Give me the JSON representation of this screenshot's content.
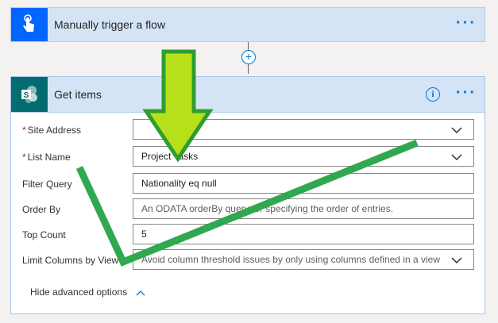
{
  "trigger": {
    "title": "Manually trigger a flow",
    "icon": "touch-hand-icon",
    "color": "#0066ff"
  },
  "action": {
    "title": "Get items",
    "icon": "sharepoint-icon",
    "color": "#036c70",
    "info_symbol": "i",
    "fields": {
      "site_address": {
        "label": "Site Address",
        "required": "*",
        "value": ""
      },
      "list_name": {
        "label": "List Name",
        "required": "*",
        "value": "Project Tasks"
      },
      "filter_query": {
        "label": "Filter Query",
        "value": "Nationality eq null"
      },
      "order_by": {
        "label": "Order By",
        "placeholder": "An ODATA orderBy query for specifying the order of entries."
      },
      "top_count": {
        "label": "Top Count",
        "value": "5"
      },
      "limit_columns": {
        "label": "Limit Columns by View",
        "placeholder": "Avoid column threshold issues by only using columns defined in a view"
      }
    },
    "advanced_toggle": "Hide advanced options"
  },
  "ellipsis": "···",
  "add_symbol": "+",
  "annotation_colors": {
    "arrow": "#b8e01a",
    "arrow_border": "#2e9e2e",
    "strike": "#2fa84f"
  }
}
